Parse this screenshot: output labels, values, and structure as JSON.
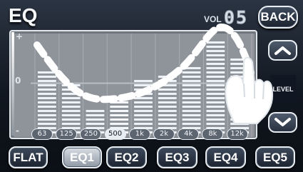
{
  "header": {
    "title": "EQ",
    "volume_label": "VOL",
    "volume_value": "05",
    "back_label": "BACK"
  },
  "eq": {
    "scale": {
      "top": "+",
      "middle": "0",
      "bottom": "-"
    },
    "bands": [
      {
        "label": "63",
        "level": 0.65
      },
      {
        "label": "125",
        "level": 0.49
      },
      {
        "label": "250",
        "level": 0.28
      },
      {
        "label": "500",
        "level": 0.38
      },
      {
        "label": "1k",
        "level": 0.55
      },
      {
        "label": "2k",
        "level": 0.6
      },
      {
        "label": "4k",
        "level": 0.69
      },
      {
        "label": "8k",
        "level": 0.94
      },
      {
        "label": "12k",
        "level": 0.77
      }
    ],
    "selected_band": "500",
    "side_control": {
      "label": "LEVEL"
    }
  },
  "presets": [
    "FLAT",
    "EQ1",
    "EQ2",
    "EQ3",
    "EQ4",
    "EQ5"
  ],
  "selected_preset": "EQ1",
  "colors": {
    "accent": "#eef2f6",
    "active_band": "#e7ecf1",
    "panel": "#8f949a",
    "dark_bg": "#151a22"
  }
}
